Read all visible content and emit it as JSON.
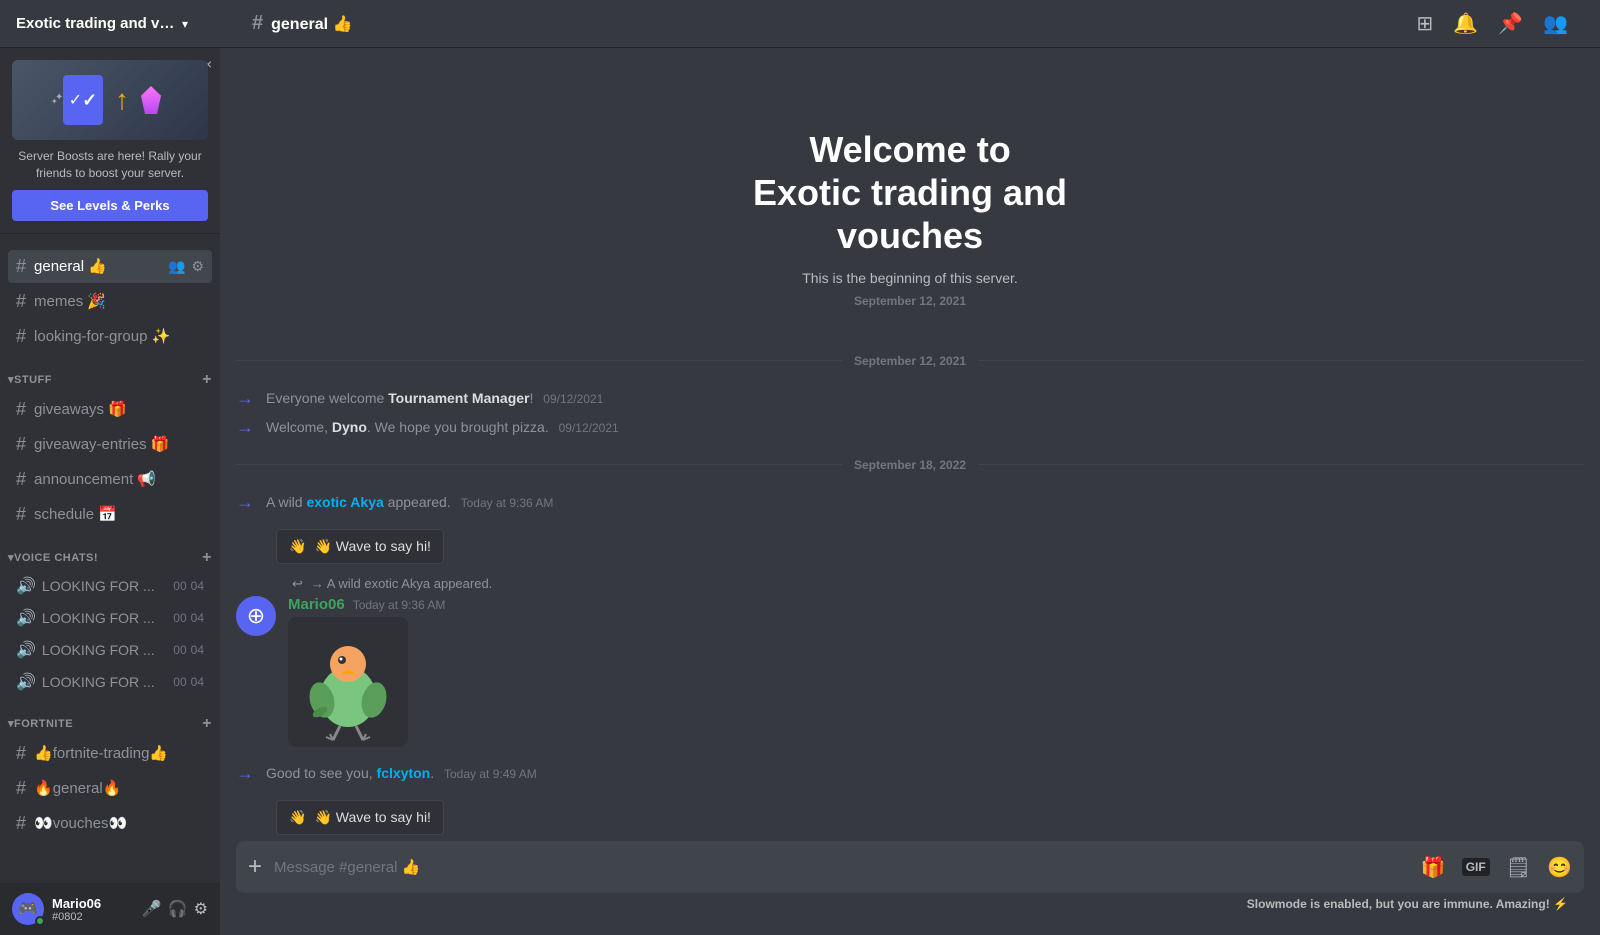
{
  "topbar": {
    "server_name": "Exotic trading and vouc...",
    "channel_name": "general",
    "channel_emoji": "👍"
  },
  "boost_banner": {
    "title_text": "Server Boosts are here! Rally your friends to boost your server.",
    "button_label": "See Levels & Perks",
    "close_label": "×"
  },
  "channels": {
    "section_general": {
      "items": [
        {
          "name": "general",
          "emoji": "👍",
          "active": true
        },
        {
          "name": "memes",
          "emoji": "🎉"
        },
        {
          "name": "looking-for-group",
          "emoji": "✨"
        }
      ]
    },
    "section_stuff": {
      "label": "STUFF",
      "items": [
        {
          "name": "giveaways",
          "emoji": "🎁"
        },
        {
          "name": "giveaway-entries",
          "emoji": "🎁"
        },
        {
          "name": "announcement",
          "emoji": "📢"
        },
        {
          "name": "schedule",
          "emoji": "📅"
        }
      ]
    },
    "section_voice": {
      "label": "VOICE CHATS!",
      "items": [
        {
          "name": "LOOKING FOR ...",
          "count_00": "00",
          "count_04": "04"
        },
        {
          "name": "LOOKING FOR ...",
          "count_00": "00",
          "count_04": "04"
        },
        {
          "name": "LOOKING FOR ...",
          "count_00": "00",
          "count_04": "04"
        },
        {
          "name": "LOOKING FOR ...",
          "count_00": "00",
          "count_04": "04"
        }
      ]
    },
    "section_fortnite": {
      "label": "FORTNITE",
      "items": [
        {
          "name": "👍fortnite-trading👍"
        },
        {
          "name": "🔥general🔥"
        },
        {
          "name": "👀vouches👀"
        }
      ]
    }
  },
  "welcome": {
    "title": "Welcome to\nExotic trading and\nvouches",
    "subtitle": "This is the beginning of this server.",
    "date": "September 12, 2021"
  },
  "messages": {
    "date_sep_1": "September 12, 2021",
    "date_sep_2": "September 18, 2022",
    "system_msgs": [
      {
        "text_pre": "Everyone welcome ",
        "highlight": "Tournament Manager",
        "text_post": "!",
        "time": "09/12/2021"
      },
      {
        "text_pre": "Welcome, ",
        "highlight": "Dyno",
        "text_post": ". We hope you brought pizza.",
        "time": "09/12/2021"
      }
    ],
    "join_msg_1": {
      "pre": "A wild ",
      "highlight": "exotic Akya",
      "post": " appeared.",
      "time": "Today at 9:36 AM",
      "wave_label": "👋 Wave to say hi!"
    },
    "user_msg_1": {
      "replied_text": "→ A wild exotic Akya appeared.",
      "author": "Mario06",
      "author_color": "green",
      "time": "Today at 9:36 AM",
      "bird_emoji": "🦜"
    },
    "join_msg_2": {
      "pre": "Good to see you, ",
      "highlight": "fclxyton",
      "post": ".",
      "time": "Today at 9:49 AM",
      "wave_label": "👋 Wave to say hi!"
    }
  },
  "input": {
    "placeholder": "Message #general 👍"
  },
  "slowmode": {
    "text": "Slowmode is enabled, but you are immune. Amazing! ⚡"
  },
  "user": {
    "name": "Mario06",
    "tag": "#0802",
    "avatar_emoji": "🎮"
  },
  "icons": {
    "hash": "#",
    "chevron": "▾",
    "search": "🔍",
    "bell": "🔔",
    "pin": "📌",
    "people": "👥",
    "plus": "+",
    "gift": "🎁",
    "gif": "GIF",
    "sticker": "🗒",
    "emoji": "😊",
    "mic": "🎤",
    "headset": "🎧",
    "gear": "⚙",
    "voice_speaker": "🔊"
  }
}
